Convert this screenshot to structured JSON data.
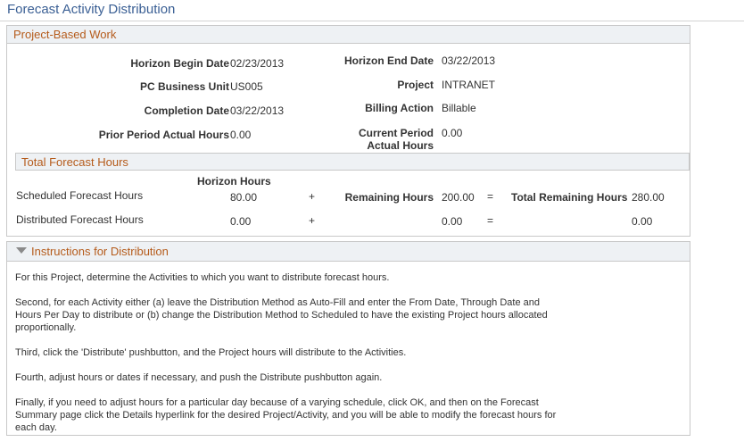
{
  "page": {
    "title": "Forecast Activity Distribution"
  },
  "project_section": {
    "header": "Project-Based Work",
    "horizon_begin_label": "Horizon Begin Date",
    "horizon_begin_value": "02/23/2013",
    "horizon_end_label": "Horizon End Date",
    "horizon_end_value": "03/22/2013",
    "business_unit_label": "PC Business Unit",
    "business_unit_value": "US005",
    "project_label": "Project",
    "project_value": "INTRANET",
    "completion_label": "Completion Date",
    "completion_value": "03/22/2013",
    "billing_label": "Billing Action",
    "billing_value": "Billable",
    "prior_label": "Prior Period Actual Hours",
    "prior_value": "0.00",
    "current_label_line1": "Current Period",
    "current_label_line2": "Actual Hours",
    "current_value": "0.00"
  },
  "forecast": {
    "header": "Total Forecast Hours",
    "horizon_hours_label": "Horizon Hours",
    "scheduled_label": "Scheduled Forecast Hours",
    "scheduled_horizon": "80.00",
    "plus": "+",
    "remaining_label": "Remaining Hours",
    "scheduled_remaining": "200.00",
    "equals": "=",
    "total_remaining_label": "Total Remaining Hours",
    "scheduled_total": "280.00",
    "distributed_label": "Distributed Forecast Hours",
    "distributed_horizon": "0.00",
    "distributed_remaining": "0.00",
    "distributed_total": "0.00"
  },
  "instructions": {
    "header": "Instructions for Distribution",
    "p1": "For this Project, determine the Activities to which you want to distribute forecast hours.",
    "p2_l1": "Second, for each Activity either (a) leave the Distribution Method as Auto-Fill and enter the From Date, Through Date and",
    "p2_l2": "Hours Per Day to distribute or (b) change the Distribution Method to Scheduled to have the existing Project hours allocated",
    "p2_l3": "proportionally.",
    "p3": "Third, click the 'Distribute' pushbutton, and the Project hours will distribute to the Activities.",
    "p4": "Fourth, adjust hours or dates if necessary, and push the Distribute pushbutton again.",
    "p5_l1": "Finally, if you need to adjust hours for a particular day because of a varying schedule, click OK, and then on the Forecast",
    "p5_l2": "Summary page click the Details hyperlink for the desired Project/Activity, and you will be able to modify the forecast hours for",
    "p5_l3": "each day."
  }
}
